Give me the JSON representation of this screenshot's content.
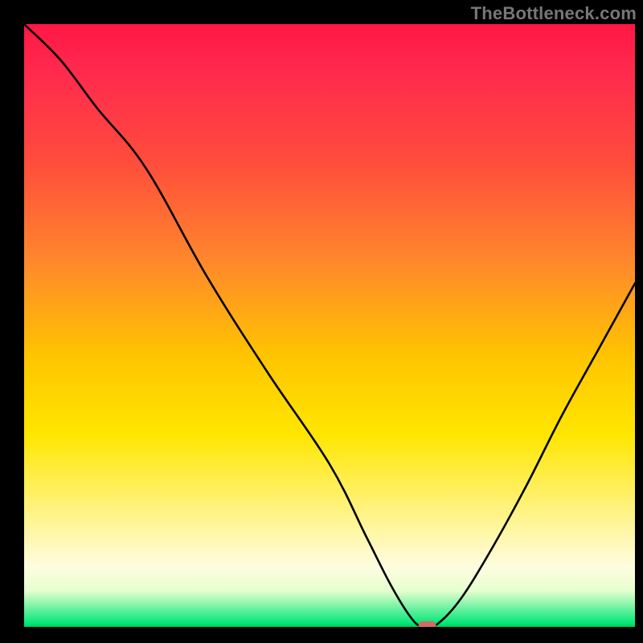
{
  "watermark": "TheBottleneck.com",
  "chart_data": {
    "type": "line",
    "title": "",
    "xlabel": "",
    "ylabel": "",
    "xlim": [
      0,
      100
    ],
    "ylim": [
      0,
      100
    ],
    "grid": false,
    "series": [
      {
        "name": "bottleneck-curve",
        "x": [
          0,
          6,
          12,
          20,
          30,
          40,
          50,
          56,
          60,
          63,
          65,
          67,
          71,
          76,
          82,
          88,
          94,
          100
        ],
        "values": [
          100,
          94,
          86,
          76,
          58,
          42,
          27,
          15,
          7,
          2,
          0,
          0,
          4,
          12,
          23,
          35,
          46,
          57
        ]
      }
    ],
    "marker": {
      "x": 66,
      "y": 0,
      "label": "",
      "color": "#d26a66"
    },
    "background": {
      "type": "vertical-gradient",
      "stops": [
        {
          "pos": 0.0,
          "color": "#ff1744"
        },
        {
          "pos": 0.08,
          "color": "#ff2a4d"
        },
        {
          "pos": 0.22,
          "color": "#ff4a3d"
        },
        {
          "pos": 0.4,
          "color": "#ff8a2b"
        },
        {
          "pos": 0.55,
          "color": "#ffc400"
        },
        {
          "pos": 0.68,
          "color": "#ffe600"
        },
        {
          "pos": 0.8,
          "color": "#fff27a"
        },
        {
          "pos": 0.9,
          "color": "#fffce0"
        },
        {
          "pos": 0.94,
          "color": "#e6ffcf"
        },
        {
          "pos": 0.995,
          "color": "#00e676"
        },
        {
          "pos": 1.0,
          "color": "#00c853"
        }
      ]
    }
  }
}
